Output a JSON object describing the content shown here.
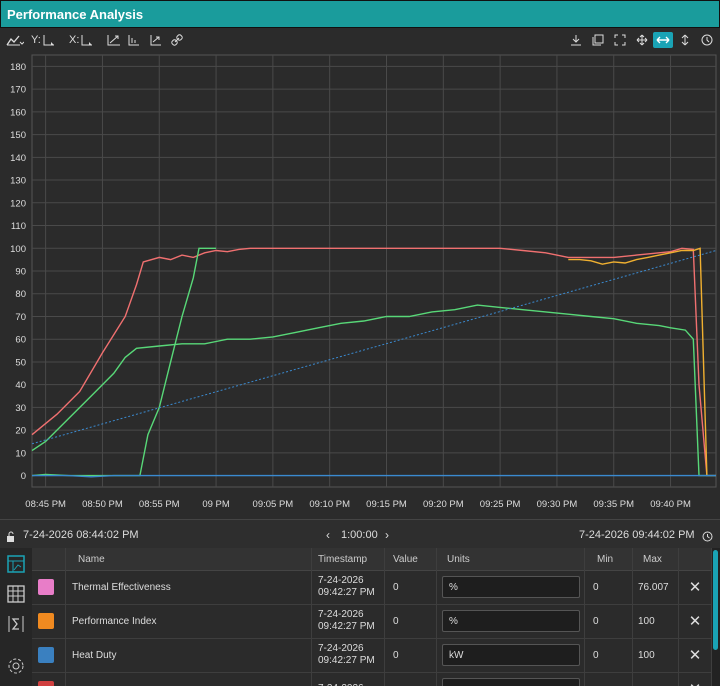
{
  "window": {
    "title": "Performance Analysis"
  },
  "toolbar": {
    "y_label": "Y:",
    "x_label": "X:",
    "left_icons": [
      "chart-type-icon",
      "y-axis-icon",
      "x-axis-icon",
      "zoom-extents-icon",
      "bar-chart-icon",
      "trend-icon",
      "link-icon"
    ],
    "right_icons": [
      "download-icon",
      "copy-icon",
      "fullscreen-icon",
      "pan-icon",
      "horizontal-zoom-icon",
      "vertical-zoom-icon",
      "reset-icon"
    ]
  },
  "colors": {
    "title_bar": "#1a9c9c",
    "accent": "#1aa3b5",
    "series_red": "#f07070",
    "series_orange": "#f0b030",
    "series_green": "#58d878",
    "series_blue": "#3a8ad0"
  },
  "chart_data": {
    "type": "line",
    "y_ticks": [
      0,
      10,
      20,
      30,
      40,
      50,
      60,
      70,
      80,
      90,
      100,
      110,
      120,
      130,
      140,
      150,
      160,
      170,
      180
    ],
    "x_ticks": [
      "08:45 PM",
      "08:50 PM",
      "08:55 PM",
      "09 PM",
      "09:05 PM",
      "09:10 PM",
      "09:15 PM",
      "09:20 PM",
      "09:25 PM",
      "09:30 PM",
      "09:35 PM",
      "09:40 PM"
    ],
    "x_tick_minutes": [
      0,
      5,
      10,
      15,
      20,
      25,
      30,
      35,
      40,
      45,
      50,
      55
    ],
    "xlim_minutes": [
      -1.2,
      59.0
    ],
    "ylim": [
      -5,
      185
    ],
    "grid": true,
    "series": [
      {
        "color_key": "series_red",
        "style": "solid",
        "points": [
          [
            -1.2,
            18
          ],
          [
            1,
            27
          ],
          [
            3,
            37
          ],
          [
            5,
            54
          ],
          [
            7,
            70
          ],
          [
            8,
            84
          ],
          [
            8.6,
            94
          ],
          [
            10,
            96
          ],
          [
            11,
            95
          ],
          [
            12,
            97
          ],
          [
            13,
            96
          ],
          [
            14,
            98
          ],
          [
            15,
            99
          ],
          [
            16,
            98.5
          ],
          [
            17,
            99.5
          ],
          [
            18,
            100
          ],
          [
            25,
            100
          ],
          [
            35,
            100
          ],
          [
            40,
            100
          ],
          [
            42,
            99
          ],
          [
            44,
            98
          ],
          [
            46,
            96
          ],
          [
            48,
            96
          ],
          [
            50,
            96
          ],
          [
            52,
            97
          ],
          [
            54,
            98
          ],
          [
            55,
            98.5
          ],
          [
            56,
            100
          ],
          [
            57,
            99.5
          ],
          [
            57.5,
            40
          ],
          [
            58.2,
            0
          ],
          [
            59,
            0
          ]
        ]
      },
      {
        "color_key": "series_orange",
        "style": "solid",
        "points": [
          [
            46,
            95
          ],
          [
            47,
            95
          ],
          [
            48,
            94.5
          ],
          [
            49,
            93
          ],
          [
            50,
            94
          ],
          [
            51,
            93.5
          ],
          [
            52,
            95
          ],
          [
            53,
            96
          ],
          [
            54,
            97
          ],
          [
            55,
            98
          ],
          [
            56,
            99
          ],
          [
            57,
            99
          ],
          [
            57.6,
            100
          ],
          [
            58.2,
            0
          ]
        ]
      },
      {
        "color_key": "series_green",
        "style": "solid",
        "points": [
          [
            -1.2,
            11
          ],
          [
            0,
            15
          ],
          [
            2,
            25
          ],
          [
            4,
            35
          ],
          [
            6,
            45
          ],
          [
            7,
            52
          ],
          [
            8,
            56
          ],
          [
            10,
            57
          ],
          [
            12,
            58
          ],
          [
            14,
            58
          ],
          [
            15,
            59
          ],
          [
            16,
            60
          ],
          [
            18,
            60
          ],
          [
            20,
            61
          ],
          [
            22,
            63
          ],
          [
            24,
            65
          ],
          [
            26,
            67
          ],
          [
            28,
            68
          ],
          [
            30,
            70
          ],
          [
            32,
            70
          ],
          [
            34,
            72
          ],
          [
            36,
            73
          ],
          [
            38,
            75
          ],
          [
            40,
            74
          ],
          [
            42,
            73
          ],
          [
            44,
            72
          ],
          [
            46,
            71
          ],
          [
            48,
            70
          ],
          [
            50,
            69
          ],
          [
            52,
            67
          ],
          [
            54,
            66
          ],
          [
            55,
            65
          ],
          [
            56.3,
            64
          ],
          [
            57,
            60
          ],
          [
            57.5,
            0
          ],
          [
            59,
            0
          ]
        ]
      },
      {
        "color_key": "series_green",
        "style": "solid",
        "points": [
          [
            -1.2,
            0
          ],
          [
            0,
            0.5
          ],
          [
            2,
            0
          ],
          [
            4,
            0
          ],
          [
            6,
            0
          ],
          [
            7.5,
            0
          ],
          [
            8.3,
            0
          ],
          [
            9,
            18
          ],
          [
            10,
            30
          ],
          [
            11,
            50
          ],
          [
            12,
            70
          ],
          [
            13,
            87
          ],
          [
            13.5,
            100
          ],
          [
            15,
            100
          ]
        ]
      },
      {
        "color_key": "series_blue",
        "style": "solid",
        "points": [
          [
            -1.2,
            0
          ],
          [
            0,
            0
          ],
          [
            2,
            0
          ],
          [
            4,
            -0.5
          ],
          [
            6,
            0
          ],
          [
            8,
            0
          ],
          [
            57.5,
            0
          ],
          [
            59,
            0
          ]
        ]
      },
      {
        "color_key": "series_blue",
        "style": "dotted",
        "points": [
          [
            -1.2,
            14
          ],
          [
            59,
            99
          ]
        ]
      }
    ]
  },
  "navbar": {
    "start_time": "7-24-2026 08:44:02 PM",
    "duration": "1:00:00",
    "end_time": "7-24-2026 09:44:02 PM"
  },
  "table": {
    "headers": {
      "name": "Name",
      "timestamp": "Timestamp",
      "value": "Value",
      "units": "Units",
      "min": "Min",
      "max": "Max"
    },
    "rows": [
      {
        "color": "#e87dc8",
        "name": "Thermal Effectiveness",
        "ts_date": "7-24-2026",
        "ts_time": "09:42:27 PM",
        "value": "0",
        "units": "%",
        "min": "0",
        "max": "76.007"
      },
      {
        "color": "#f08a20",
        "name": "Performance Index",
        "ts_date": "7-24-2026",
        "ts_time": "09:42:27 PM",
        "value": "0",
        "units": "%",
        "min": "0",
        "max": "100"
      },
      {
        "color": "#3a80c0",
        "name": "Heat Duty",
        "ts_date": "7-24-2026",
        "ts_time": "09:42:27 PM",
        "value": "0",
        "units": "kW",
        "min": "0",
        "max": "100"
      },
      {
        "color": "#d04040",
        "name": "",
        "ts_date": "7-24-2026",
        "ts_time": "",
        "value": "",
        "units": "",
        "min": "",
        "max": ""
      }
    ]
  }
}
